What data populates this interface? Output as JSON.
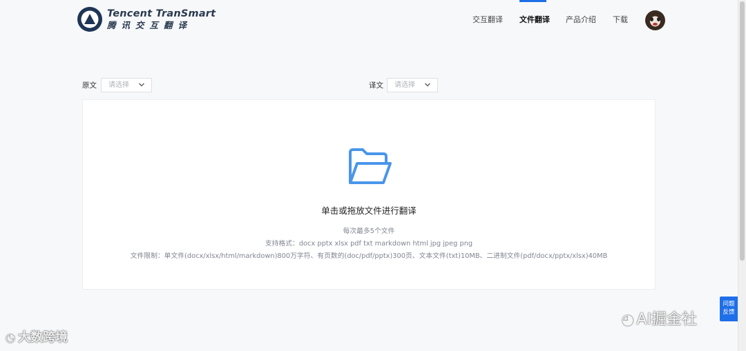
{
  "brand": {
    "name_en": "Tencent TranSmart",
    "name_cn": "腾讯交互翻译",
    "accent_color": "#1e6fe8"
  },
  "nav": {
    "items": [
      {
        "label": "交互翻译",
        "active": false
      },
      {
        "label": "文件翻译",
        "active": true
      },
      {
        "label": "产品介绍",
        "active": false
      },
      {
        "label": "下载",
        "active": false
      }
    ],
    "avatar_icon": "user-avatar"
  },
  "source_lang": {
    "label": "原文",
    "placeholder": "请选择"
  },
  "target_lang": {
    "label": "译文",
    "placeholder": "请选择"
  },
  "upload": {
    "icon": "folder-open-icon",
    "title": "单击或拖放文件进行翻译",
    "limit_count": "每次最多5个文件",
    "formats": "支持格式：docx pptx xlsx pdf txt markdown html jpg jpeg png",
    "size_limits": "文件限制：单文件(docx/xlsx/html/markdown)800万字符、有页数的(doc/pdf/pptx)300页、文本文件(txt)10MB、二进制文件(pdf/docx/pptx/xlsx)40MB"
  },
  "feedback": {
    "label_line1": "问题",
    "label_line2": "反馈"
  },
  "watermarks": {
    "left": "大数跨境",
    "right": "AI掘金社"
  }
}
